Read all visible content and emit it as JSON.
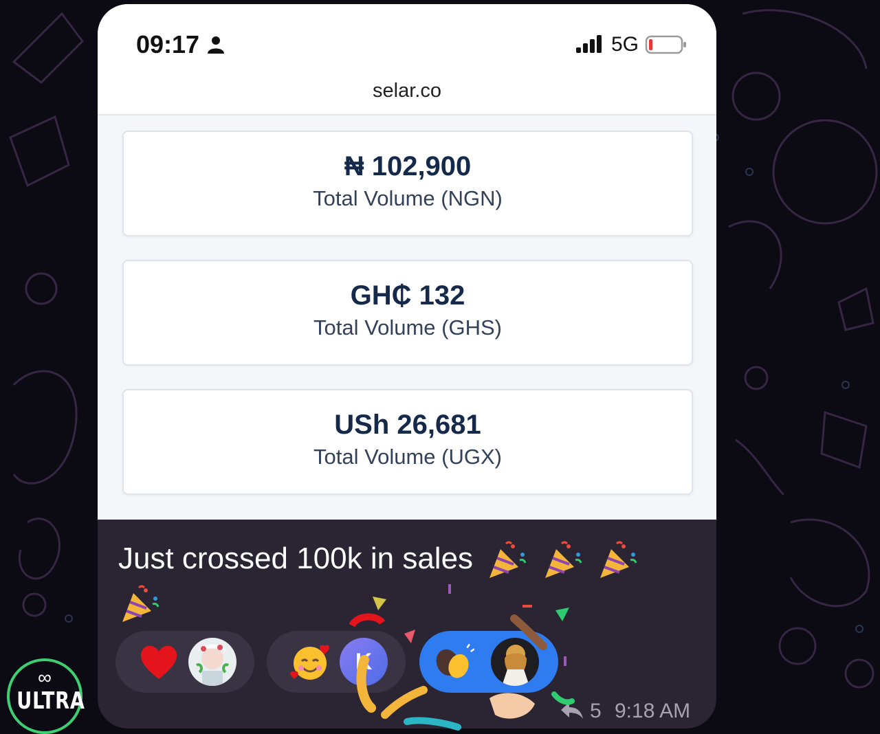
{
  "status_bar": {
    "time": "09:17",
    "network": "5G",
    "icons": [
      "person-icon",
      "signal-icon",
      "battery-low-icon"
    ]
  },
  "browser": {
    "url": "selar.co"
  },
  "cards": [
    {
      "amount": "₦ 102,900",
      "label": "Total Volume (NGN)"
    },
    {
      "amount": "GH₵ 132",
      "label": "Total Volume (GHS)"
    },
    {
      "amount": "USh 26,681",
      "label": "Total Volume (UGX)"
    }
  ],
  "message": {
    "caption": "Just crossed 100k in sales",
    "caption_emoji": [
      "party-popper",
      "party-popper",
      "party-popper",
      "party-popper"
    ],
    "reply_count": "5",
    "timestamp": "9:18 AM"
  },
  "reactions": [
    {
      "emoji": "red-heart",
      "avatar": "user-avatar-1",
      "selected": false
    },
    {
      "emoji": "smiling-face-with-hearts",
      "avatar_letter": "K",
      "selected": false
    },
    {
      "emoji": "clapping-hands",
      "avatar": "user-avatar-2",
      "selected": true
    }
  ],
  "logo": {
    "symbol": "∞",
    "text": "ULTRA"
  },
  "colors": {
    "amount_text": "#15294a",
    "selected_reaction": "#2f7bf0",
    "logo_ring": "#3fcf73",
    "bubble_bg": "#2a2433"
  }
}
